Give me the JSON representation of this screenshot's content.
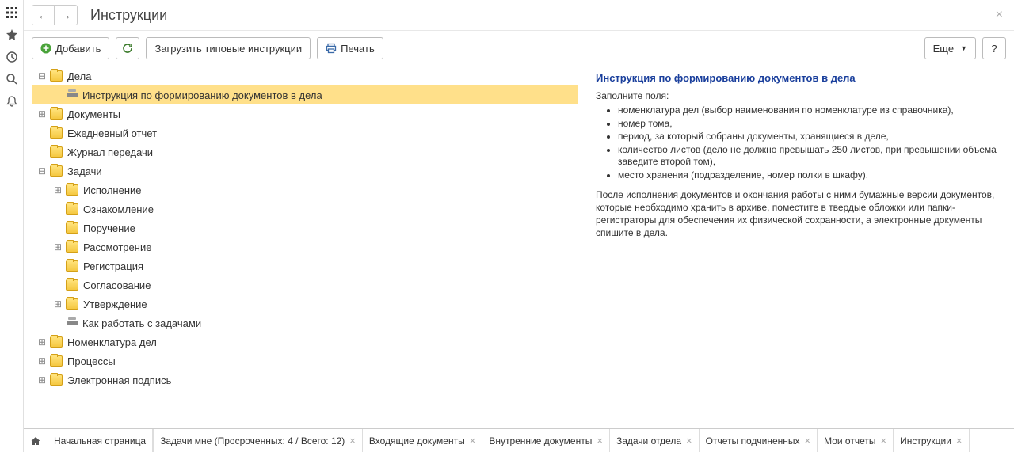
{
  "header": {
    "title": "Инструкции"
  },
  "toolbar": {
    "add": "Добавить",
    "load_typical": "Загрузить типовые инструкции",
    "print": "Печать",
    "more": "Еще",
    "help": "?"
  },
  "tree": [
    {
      "level": 0,
      "exp": "minus",
      "icon": "folder",
      "label": "Дела",
      "sel": false
    },
    {
      "level": 1,
      "exp": "none",
      "icon": "doc",
      "label": "Инструкция по формированию документов в дела",
      "sel": true
    },
    {
      "level": 0,
      "exp": "plus",
      "icon": "folder",
      "label": "Документы",
      "sel": false
    },
    {
      "level": 0,
      "exp": "none",
      "icon": "folder",
      "label": "Ежедневный отчет",
      "sel": false
    },
    {
      "level": 0,
      "exp": "none",
      "icon": "folder",
      "label": "Журнал передачи",
      "sel": false
    },
    {
      "level": 0,
      "exp": "minus",
      "icon": "folder",
      "label": "Задачи",
      "sel": false
    },
    {
      "level": 1,
      "exp": "plus",
      "icon": "folder",
      "label": "Исполнение",
      "sel": false
    },
    {
      "level": 1,
      "exp": "none",
      "icon": "folder",
      "label": "Ознакомление",
      "sel": false
    },
    {
      "level": 1,
      "exp": "none",
      "icon": "folder",
      "label": "Поручение",
      "sel": false
    },
    {
      "level": 1,
      "exp": "plus",
      "icon": "folder",
      "label": "Рассмотрение",
      "sel": false
    },
    {
      "level": 1,
      "exp": "none",
      "icon": "folder",
      "label": "Регистрация",
      "sel": false
    },
    {
      "level": 1,
      "exp": "none",
      "icon": "folder",
      "label": "Согласование",
      "sel": false
    },
    {
      "level": 1,
      "exp": "plus",
      "icon": "folder",
      "label": "Утверждение",
      "sel": false
    },
    {
      "level": 1,
      "exp": "none",
      "icon": "doc",
      "label": "Как работать с задачами",
      "sel": false
    },
    {
      "level": 0,
      "exp": "plus",
      "icon": "folder",
      "label": "Номенклатура дел",
      "sel": false
    },
    {
      "level": 0,
      "exp": "plus",
      "icon": "folder",
      "label": "Процессы",
      "sel": false
    },
    {
      "level": 0,
      "exp": "plus",
      "icon": "folder",
      "label": "Электронная подпись",
      "sel": false
    }
  ],
  "preview": {
    "title": "Инструкция по формированию документов в дела",
    "fill_label": "Заполните поля:",
    "bullets": [
      "номенклатура дел (выбор наименования по номенклатуре из справочника),",
      "номер тома,",
      "период, за который собраны документы, хранящиеся в деле,",
      "количество листов (дело не должно превышать 250 листов, при превышении объема заведите второй том),",
      "место хранения (подразделение, номер полки в шкафу)."
    ],
    "note": "После исполнения документов и окончания работы с ними бумажные версии документов, которые необходимо хранить в архиве, поместите в твердые обложки или папки-регистраторы для обеспечения их физической сохранности, а электронные документы спишите в дела."
  },
  "tabs": {
    "start": "Начальная страница",
    "items": [
      "Задачи мне (Просроченных: 4 / Всего: 12)",
      "Входящие документы",
      "Внутренние документы",
      "Задачи отдела",
      "Отчеты подчиненных",
      "Мои отчеты",
      "Инструкции"
    ]
  }
}
